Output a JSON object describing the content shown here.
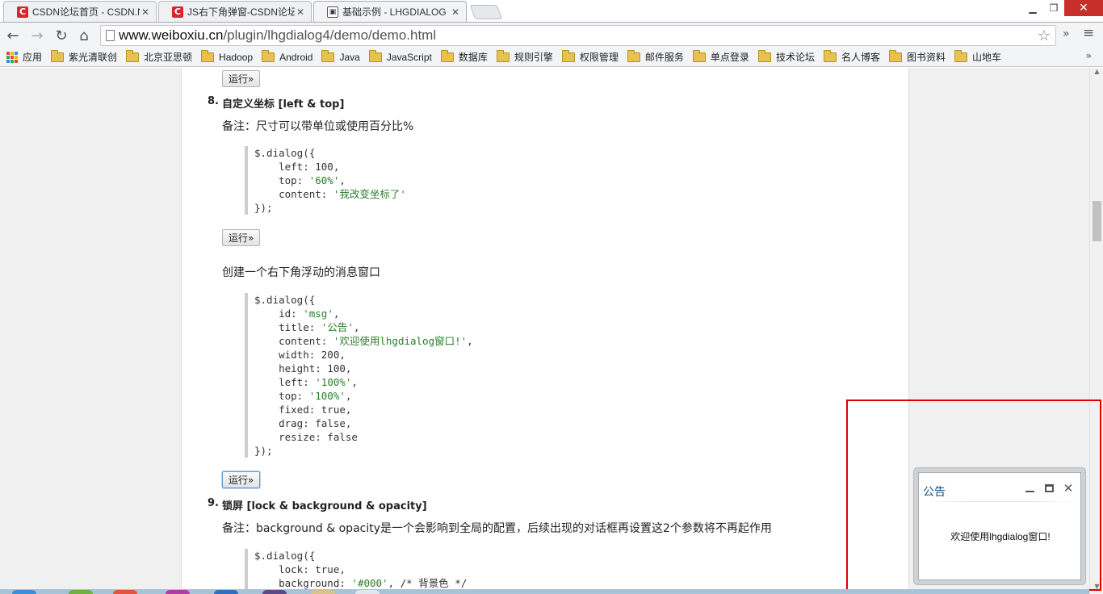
{
  "browser": {
    "tabs": [
      {
        "label": "CSDN论坛首页 - CSDN.N",
        "favicon": "csdn-icon"
      },
      {
        "label": "JS右下角弹窗-CSDN论坛",
        "favicon": "csdn-icon"
      },
      {
        "label": "基础示例 - LHGDIALOG",
        "favicon": "lhg-icon",
        "active": true
      }
    ],
    "close_glyph": "✕",
    "url_host": "www.weiboxiu.cn",
    "url_path": "/plugin/lhgdialog4/demo/demo.html",
    "bookmarks": [
      "应用",
      "紫光清联创",
      "北京亚思顿",
      "Hadoop",
      "Android",
      "Java",
      "JavaScript",
      "数据库",
      "规则引擎",
      "权限管理",
      "邮件服务",
      "单点登录",
      "技术论坛",
      "名人博客",
      "图书资料",
      "山地车"
    ],
    "bookmarks_more": "»"
  },
  "page": {
    "run_label": "运行»",
    "section8": {
      "num": "8.",
      "title": "自定义坐标 [left & top]",
      "note": "备注：尺寸可以带单位或使用百分比%",
      "code": [
        {
          "t": "$.dialog({"
        },
        {
          "t": "    left: 100,"
        },
        {
          "k": "    top: ",
          "s": "'60%'",
          "e": ","
        },
        {
          "k": "    content: ",
          "s": "'我改变坐标了'",
          "e": ""
        },
        {
          "t": "});"
        }
      ]
    },
    "msg_heading": "创建一个右下角浮动的消息窗口",
    "msg_code": [
      {
        "t": "$.dialog({"
      },
      {
        "k": "    id: ",
        "s": "'msg'",
        "e": ","
      },
      {
        "k": "    title: ",
        "s": "'公告'",
        "e": ","
      },
      {
        "k": "    content: ",
        "s": "'欢迎使用lhgdialog窗口!'",
        "e": ","
      },
      {
        "t": "    width: 200,"
      },
      {
        "t": "    height: 100,"
      },
      {
        "k": "    left: ",
        "s": "'100%'",
        "e": ","
      },
      {
        "k": "    top: ",
        "s": "'100%'",
        "e": ","
      },
      {
        "t": "    fixed: true,"
      },
      {
        "t": "    drag: false,"
      },
      {
        "t": "    resize: false"
      },
      {
        "t": "});"
      }
    ],
    "section9": {
      "num": "9.",
      "title": "锁屏 [lock & background & opacity]",
      "note": "备注：background & opacity是一个会影响到全局的配置，后续出现的对话框再设置这2个参数将不再起作用",
      "code": [
        {
          "t": "$.dialog({"
        },
        {
          "t": "    lock: true,"
        },
        {
          "k": "    background: ",
          "s": "'#000'",
          "e": ", /* 背景色 */"
        }
      ]
    }
  },
  "dialog": {
    "title": "公告",
    "body": "欢迎使用lhgdialog窗口!"
  }
}
